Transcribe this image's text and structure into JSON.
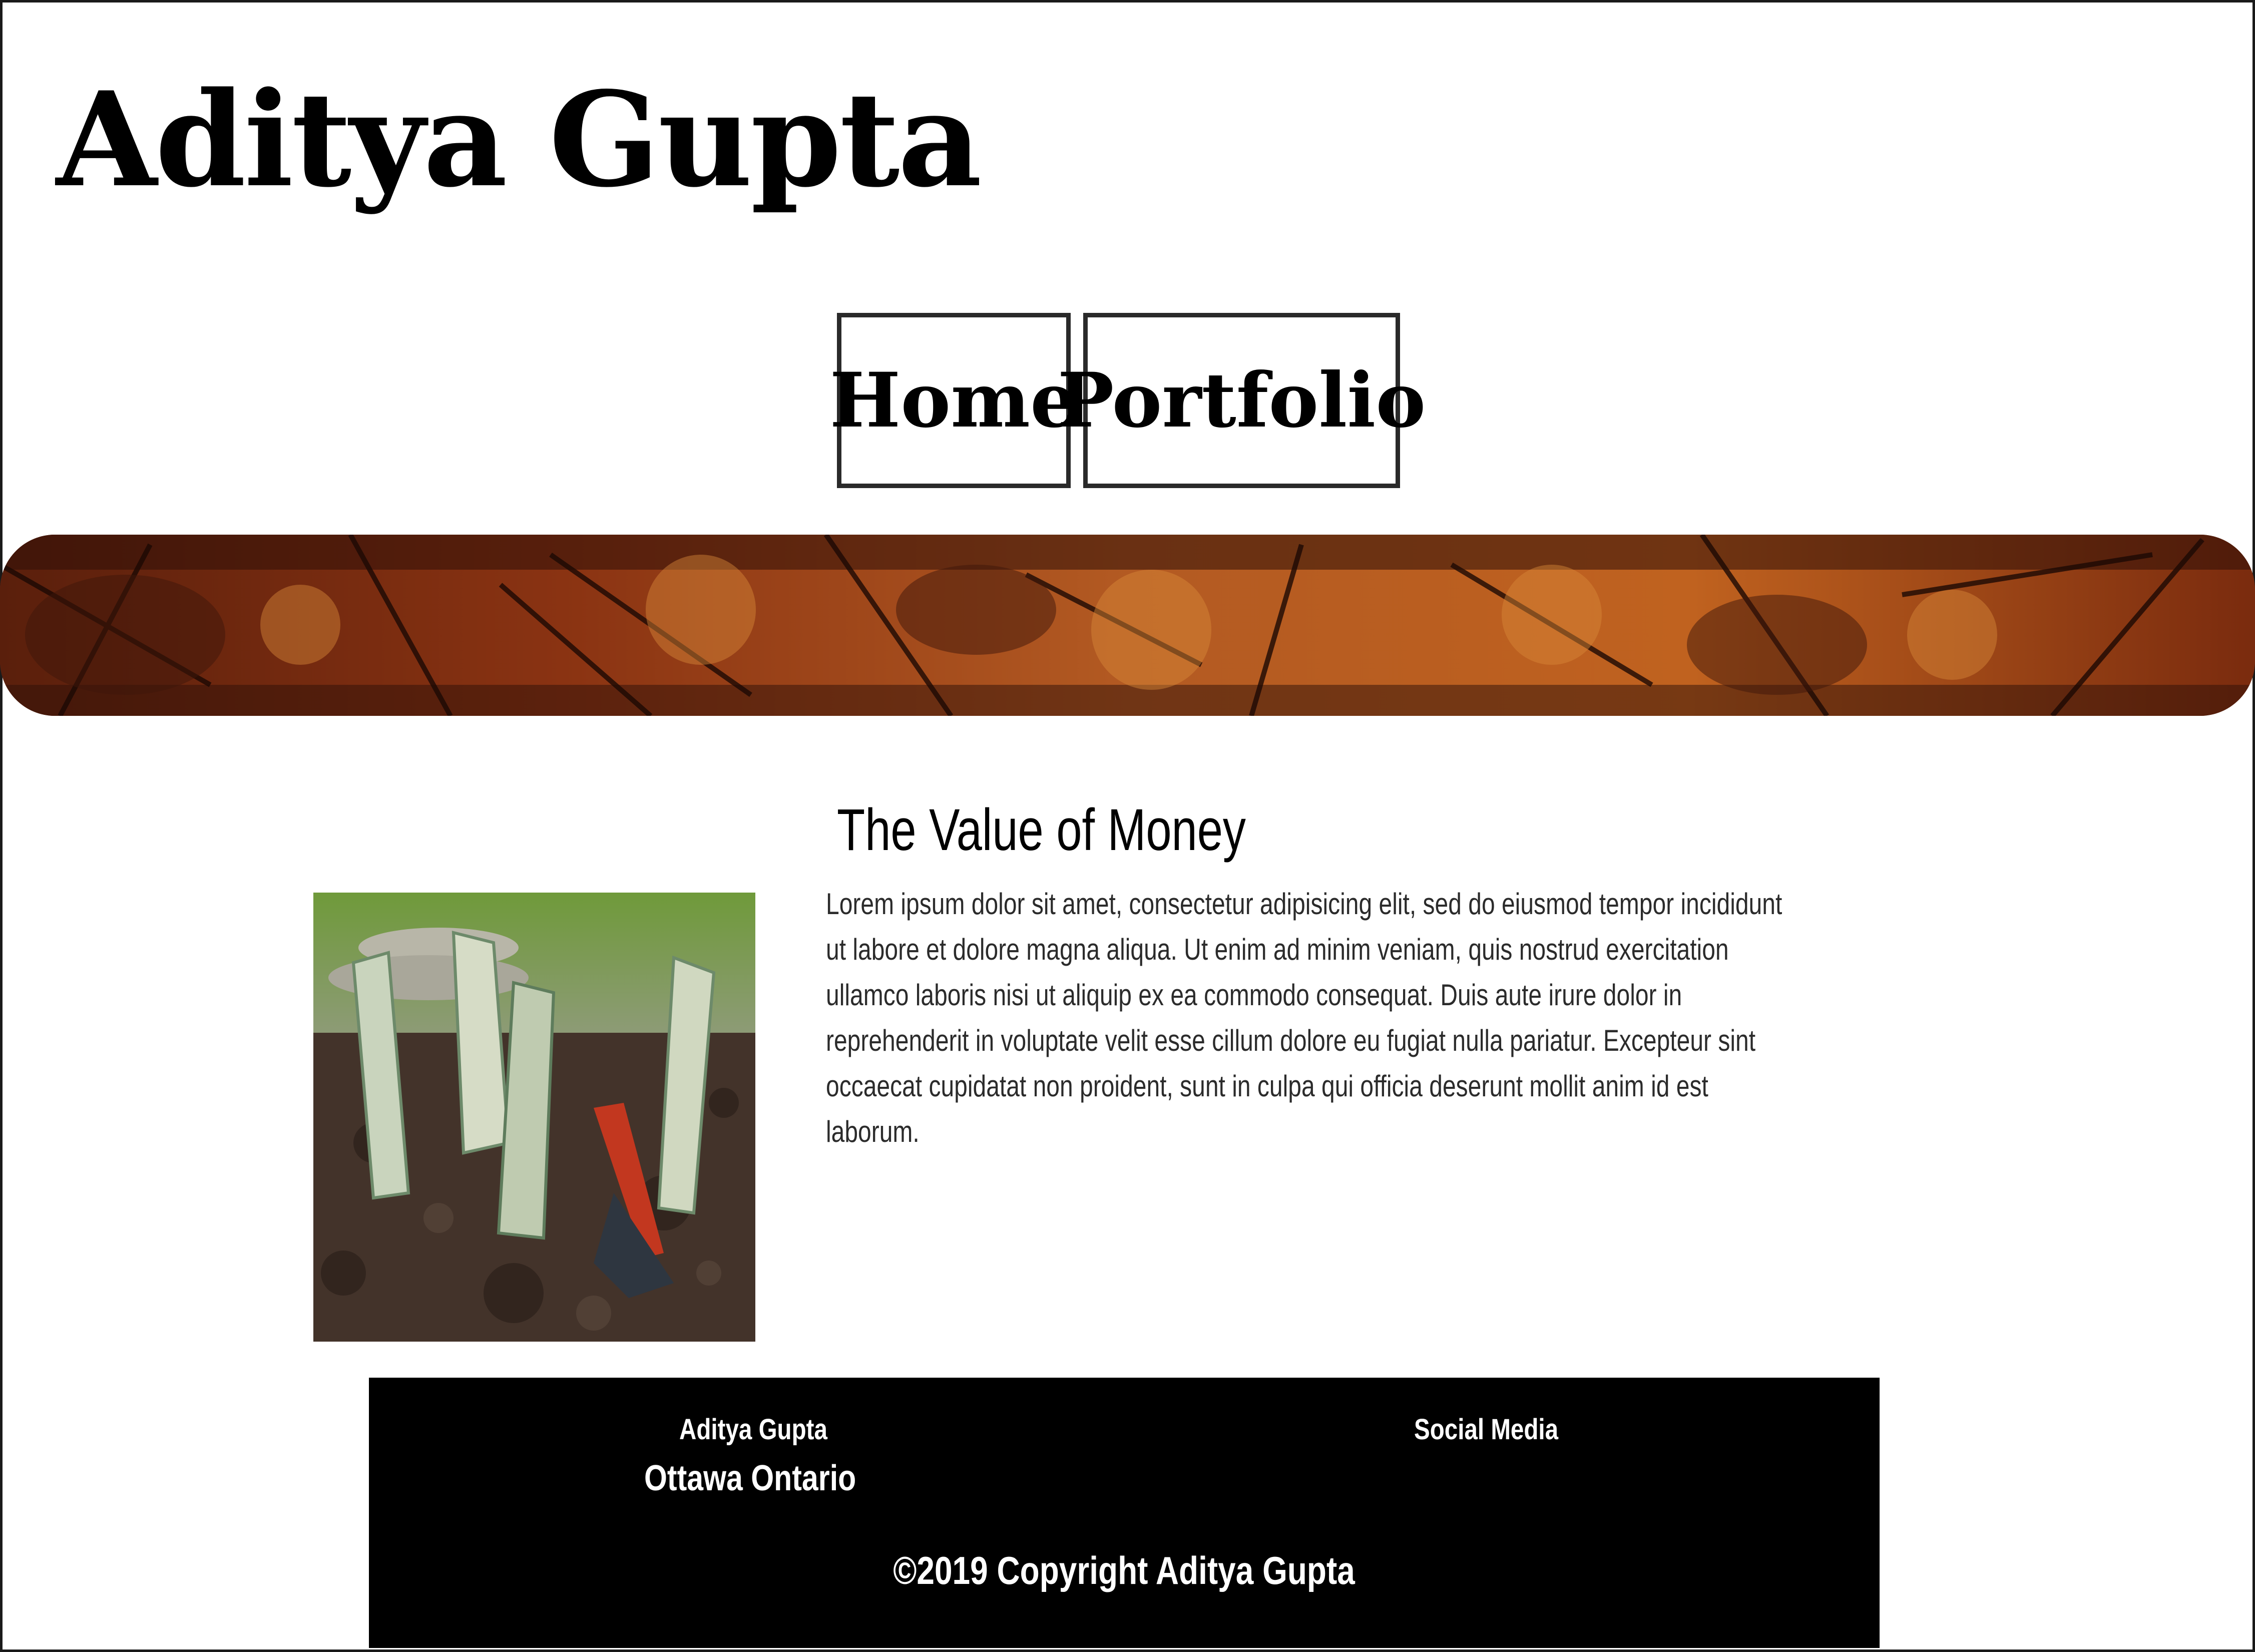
{
  "site": {
    "title": "Aditya Gupta"
  },
  "nav": {
    "home_label": "Home",
    "portfolio_label": "Portfolio"
  },
  "article": {
    "title": "The Value of Money",
    "body": "Lorem ipsum dolor sit amet, consectetur adipisicing elit, sed do eiusmod tempor incididunt ut labore et dolore magna aliqua. Ut enim ad minim veniam, quis nostrud exercitation ullamco laboris nisi ut aliquip ex ea commodo consequat. Duis aute irure dolor in reprehenderit in voluptate velit esse cillum dolore eu fugiat nulla pariatur. Excepteur sint occaecat cupidatat non proident, sunt in culpa qui officia deserunt mollit anim id est laborum."
  },
  "footer": {
    "name": "Aditya Gupta",
    "location": "Ottawa Ontario",
    "social_label": "Social Media",
    "copyright": "©2019 Copyright Aditya Gupta"
  },
  "colors": {
    "footer_bg": "#000000",
    "banner": "#a7471b"
  },
  "icons": {
    "banner_image": "autumn-foliage-image",
    "article_image": "money-plant-image"
  }
}
